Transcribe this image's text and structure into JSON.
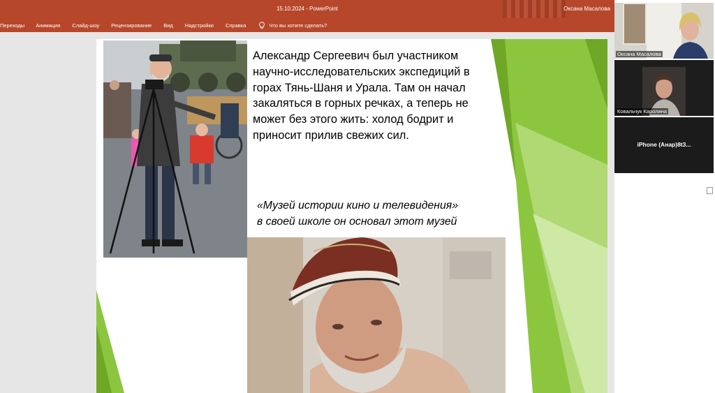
{
  "window": {
    "title": "15.10.2024  -  PowerPoint",
    "user": "Оксана Масалова"
  },
  "ribbon": {
    "tabs": [
      "Переходы",
      "Анимация",
      "Слайд-шоу",
      "Рецензирование",
      "Вид",
      "Надстройки",
      "Справка"
    ],
    "tell_me": "Что вы хотите сделать?"
  },
  "slide": {
    "body": "Александр Сергеевич был участником научно-исследовательских экспедиций в горах Тянь-Шаня и Урала. Там он начал закаляться в горных речках, а теперь не может без этого жить: холод бодрит и приносит прилив свежих сил.",
    "quote_line1": "«Музей истории кино и телевидения»",
    "quote_line2": "в своей школе он основал этот музей",
    "accent_color": "#8cc63f"
  },
  "participants": [
    {
      "name": "Оксана Масалова"
    },
    {
      "name": "Ковальчук Каролина"
    },
    {
      "name": "iPhone  (Анар)8t3..."
    }
  ]
}
